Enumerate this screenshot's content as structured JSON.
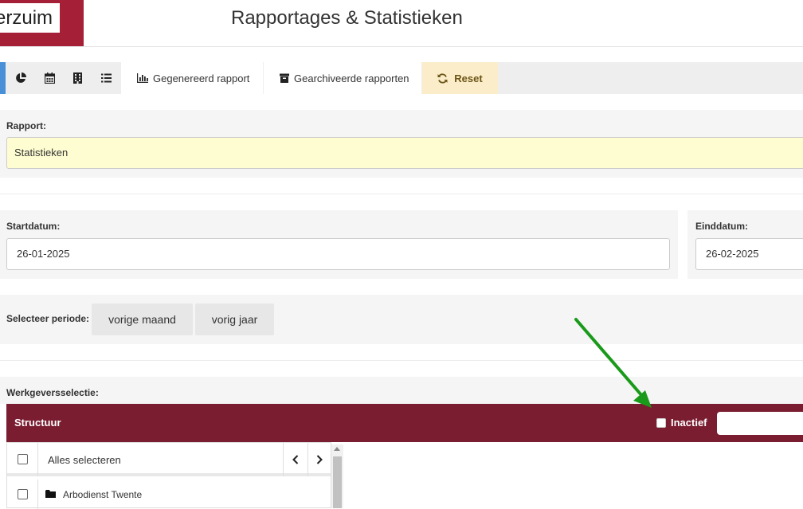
{
  "header": {
    "brand_text": "erzuim",
    "title": "Rapportages & Statistieken"
  },
  "toolbar": {
    "icons": [
      "pie-chart-icon",
      "calendar-icon",
      "building-icon",
      "list-icon"
    ],
    "tab_generated": "Gegenereerd rapport",
    "tab_archived": "Gearchiveerde rapporten",
    "reset_label": "Reset",
    "accent_color": "#4a90d9",
    "reset_bg": "#fbedc9"
  },
  "report": {
    "label": "Rapport:",
    "value": "Statistieken"
  },
  "dates": {
    "start_label": "Startdatum:",
    "start_value": "26-01-2025",
    "end_label": "Einddatum:",
    "end_value": "26-02-2025"
  },
  "period": {
    "label": "Selecteer periode:",
    "last_month": "vorige maand",
    "last_year": "vorig jaar"
  },
  "employer": {
    "label": "Werkgeversselectie:",
    "bar_title": "Structuur",
    "inactive_label": "Inactief",
    "bar_color": "#7a1d30",
    "select_all": "Alles selecteren",
    "items": [
      {
        "label": "Arbodienst Twente",
        "icon": "folder-icon"
      }
    ]
  },
  "annotation": {
    "arrow_color": "#1a9a1a"
  }
}
